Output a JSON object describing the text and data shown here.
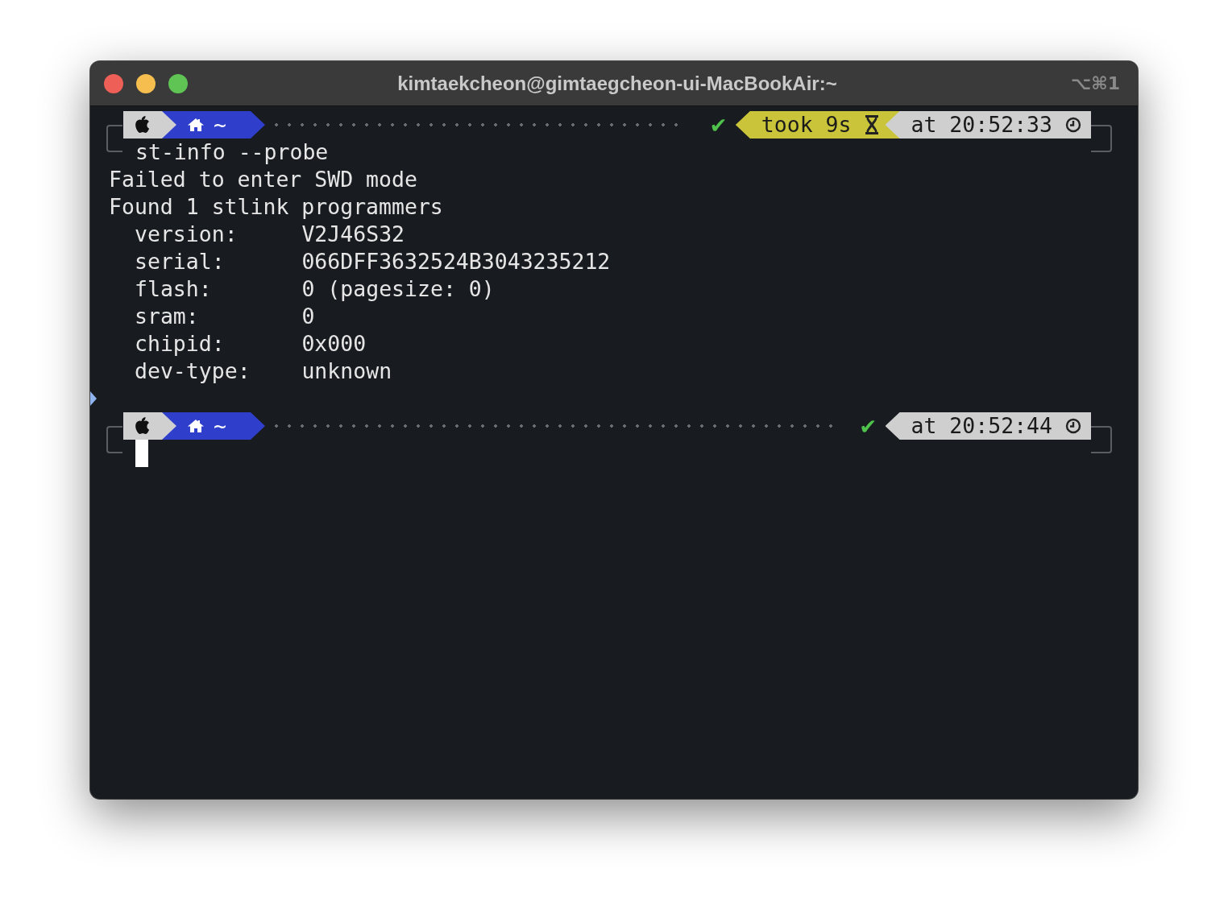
{
  "window": {
    "title": "kimtaekcheon@gimtaegcheon-ui-MacBookAir:~",
    "shortcut": "⌥⌘1"
  },
  "prompts": [
    {
      "path": "~",
      "status": "✔",
      "took": "took 9s",
      "time": "at 20:52:33",
      "command": "st-info --probe"
    },
    {
      "path": "~",
      "status": "✔",
      "time": "at 20:52:44",
      "cursor": true
    }
  ],
  "output": [
    {
      "kind": "text",
      "text": "Failed to enter SWD mode"
    },
    {
      "kind": "text",
      "text": "Found 1 stlink programmers"
    },
    {
      "kind": "field",
      "label": "version:",
      "value": "V2J46S32"
    },
    {
      "kind": "field",
      "label": "serial:",
      "value": "066DFF3632524B3043235212"
    },
    {
      "kind": "field",
      "label": "flash:",
      "value": "0 (pagesize: 0)"
    },
    {
      "kind": "field",
      "label": "sram:",
      "value": "0"
    },
    {
      "kind": "field",
      "label": "chipid:",
      "value": "0x000"
    },
    {
      "kind": "field",
      "label": "dev-type:",
      "value": "unknown"
    }
  ]
}
